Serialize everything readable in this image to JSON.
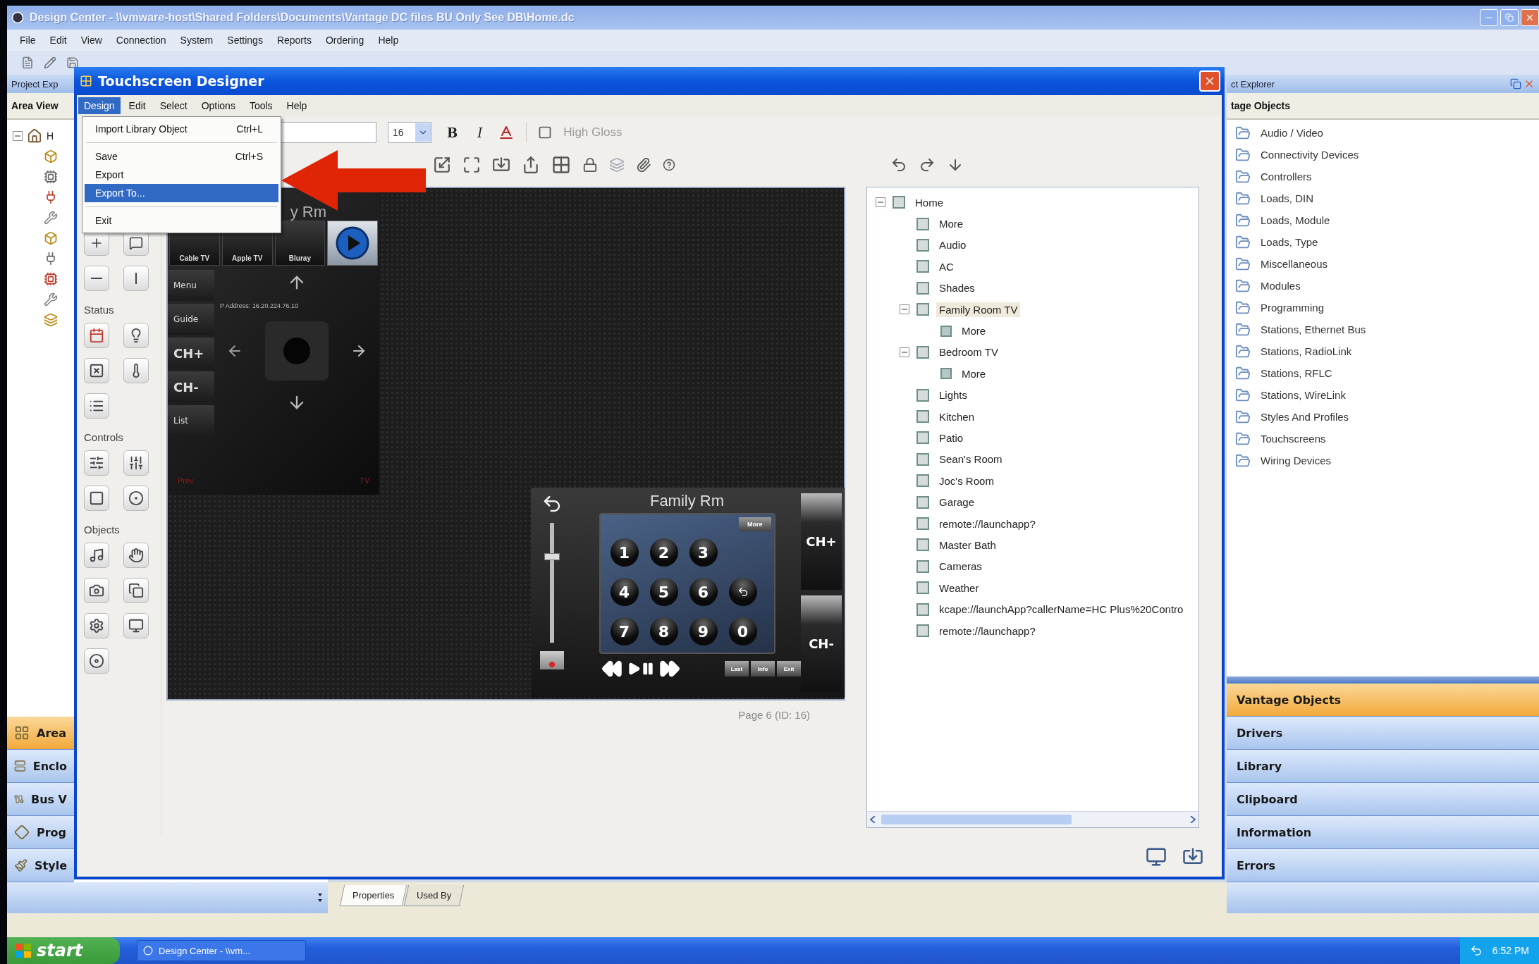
{
  "main_window": {
    "title": "Design Center - \\\\vmware-host\\Shared Folders\\Documents\\Vantage DC files BU Only See DB\\Home.dc",
    "menu": [
      "File",
      "Edit",
      "View",
      "Connection",
      "System",
      "Settings",
      "Reports",
      "Ordering",
      "Help"
    ]
  },
  "project_explorer": {
    "title": "Project Exp",
    "view_title": "Area View",
    "root_label": "H",
    "nav_buttons": [
      {
        "label": "Area",
        "selected": true
      },
      {
        "label": "Enclo",
        "selected": false
      },
      {
        "label": "Bus V",
        "selected": false
      },
      {
        "label": "Prog",
        "selected": false
      },
      {
        "label": "Style",
        "selected": false
      }
    ]
  },
  "object_explorer": {
    "title": "ct Explorer",
    "section_title": "tage Objects",
    "folders": [
      "Audio / Video",
      "Connectivity Devices",
      "Controllers",
      "Loads, DIN",
      "Loads, Module",
      "Loads, Type",
      "Miscellaneous",
      "Modules",
      "Programming",
      "Stations, Ethernet Bus",
      "Stations, RadioLink",
      "Stations, RFLC",
      "Stations, WireLink",
      "Styles And Profiles",
      "Touchscreens",
      "Wiring Devices"
    ],
    "nav_buttons": [
      {
        "label": "Vantage Objects",
        "selected": true
      },
      {
        "label": "Drivers",
        "selected": false
      },
      {
        "label": "Library",
        "selected": false
      },
      {
        "label": "Clipboard",
        "selected": false
      },
      {
        "label": "Information",
        "selected": false
      },
      {
        "label": "Errors",
        "selected": false
      }
    ]
  },
  "bottom_tabs": [
    {
      "label": "Properties",
      "selected": true
    },
    {
      "label": "Used By",
      "selected": false
    }
  ],
  "dialog": {
    "title": "Touchscreen Designer",
    "menu": [
      {
        "label": "Design",
        "selected": true
      },
      {
        "label": "Edit",
        "selected": false
      },
      {
        "label": "Select",
        "selected": false
      },
      {
        "label": "Options",
        "selected": false
      },
      {
        "label": "Tools",
        "selected": false
      },
      {
        "label": "Help",
        "selected": false
      }
    ],
    "design_menu": [
      {
        "kind": "item",
        "label": "Import Library Object",
        "shortcut": "Ctrl+L",
        "selected": false
      },
      {
        "kind": "separator"
      },
      {
        "kind": "item",
        "label": "Save",
        "shortcut": "Ctrl+S",
        "selected": false
      },
      {
        "kind": "item",
        "label": "Export",
        "selected": false
      },
      {
        "kind": "item",
        "label": "Export To...",
        "selected": true
      },
      {
        "kind": "separator"
      },
      {
        "kind": "item",
        "label": "Exit",
        "selected": false
      }
    ],
    "toolbar": {
      "font_size": "16",
      "bold": "B",
      "italic": "I",
      "style": "High Gloss"
    },
    "palette_sections": [
      "Status",
      "Controls",
      "Objects"
    ],
    "remote_panel": {
      "title": "y Rm",
      "sources": [
        "Cable TV",
        "Apple TV",
        "Bluray"
      ],
      "side_buttons": [
        "Menu",
        "Guide",
        "CH+",
        "CH-",
        "List"
      ],
      "address": "P Address: 16.20.224.76.10",
      "footer_left": "Prev",
      "footer_right": "TV"
    },
    "family_panel": {
      "title": "Family Rm",
      "more": "More",
      "keys": [
        "1",
        "2",
        "3",
        "4",
        "5",
        "6",
        "7",
        "8",
        "9",
        "0"
      ],
      "channel_up": "CH+",
      "channel_down": "CH-",
      "volume": {
        "level": 0.72
      },
      "buttons": [
        "Last",
        "Info",
        "Exit"
      ]
    },
    "page_label": "Page 6 (ID: 16)",
    "page_tree": [
      {
        "label": "Home",
        "expanded": true,
        "selected": false,
        "children": [
          {
            "label": "More",
            "selected": false
          },
          {
            "label": "Audio",
            "selected": false
          },
          {
            "label": "AC",
            "selected": false
          },
          {
            "label": "Shades",
            "selected": false
          },
          {
            "label": "Family Room TV",
            "expanded": true,
            "selected": true,
            "children": [
              {
                "label": "More",
                "selected": false
              }
            ]
          },
          {
            "label": "Bedroom TV",
            "expanded": true,
            "selected": false,
            "children": [
              {
                "label": "More",
                "selected": false
              }
            ]
          },
          {
            "label": "Lights",
            "selected": false
          },
          {
            "label": "Kitchen",
            "selected": false
          },
          {
            "label": "Patio",
            "selected": false
          },
          {
            "label": "Sean's Room",
            "selected": false
          },
          {
            "label": "Joc's Room",
            "selected": false
          },
          {
            "label": "Garage",
            "selected": false
          },
          {
            "label": "remote://launchapp?",
            "selected": false
          },
          {
            "label": "Master Bath",
            "selected": false
          },
          {
            "label": "Cameras",
            "selected": false
          },
          {
            "label": "Weather",
            "selected": false
          },
          {
            "label": "kcape://launchApp?callerName=HC Plus%20Contro",
            "selected": false
          },
          {
            "label": "remote://launchapp?",
            "selected": false
          }
        ]
      }
    ]
  },
  "taskbar": {
    "start": "start",
    "task": "Design Center - \\\\vm...",
    "clock": "6:52 PM"
  }
}
